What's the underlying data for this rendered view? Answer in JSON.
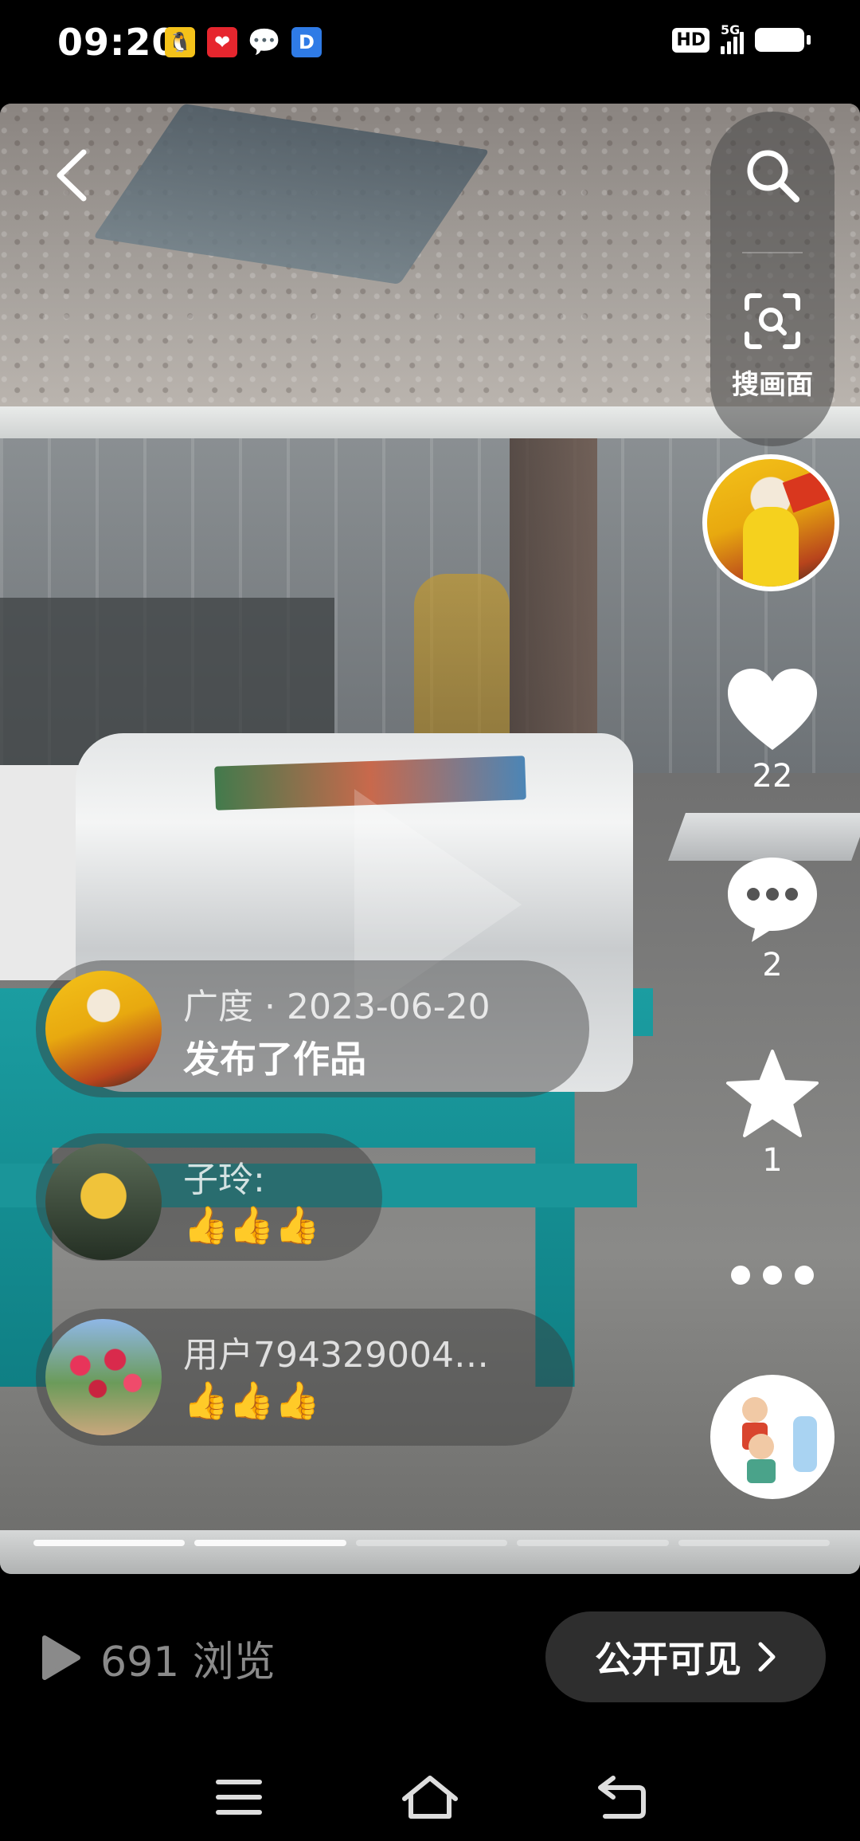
{
  "status_bar": {
    "time": "09:20",
    "apps": [
      {
        "icon": "qq-icon",
        "color": "#f4c21a"
      },
      {
        "icon": "heart-app-icon",
        "color": "#e6262e"
      },
      {
        "icon": "wechat-icon",
        "color": "#ffffff"
      },
      {
        "icon": "dingtalk-icon",
        "color": "#2f7be6"
      }
    ],
    "hd_label": "HD",
    "network_label": "5G",
    "battery_level": 0.9
  },
  "nav": {
    "back_icon": "chevron-left-icon"
  },
  "right_rail": {
    "search_icon": "search-icon",
    "scan_icon": "scan-search-icon",
    "scan_label": "搜画面",
    "like_count": "22",
    "comment_count": "2",
    "favorite_count": "1",
    "more_icon": "more-dots-icon"
  },
  "bubbles": [
    {
      "name": "广度 · 2023-06-20",
      "text": "发布了作品"
    },
    {
      "name": "子玲:",
      "text": "👍👍👍"
    },
    {
      "name": "用户794329004…",
      "text": "👍👍👍"
    }
  ],
  "progress": {
    "segments": 5,
    "current_index": 1
  },
  "footer": {
    "views_text": "691 浏览",
    "visibility_label": "公开可见"
  },
  "colors": {
    "accent_teal": "#1b9da1",
    "bubble_bg": "rgba(60,60,60,.45)",
    "pill_bg": "#2e2e2e"
  }
}
